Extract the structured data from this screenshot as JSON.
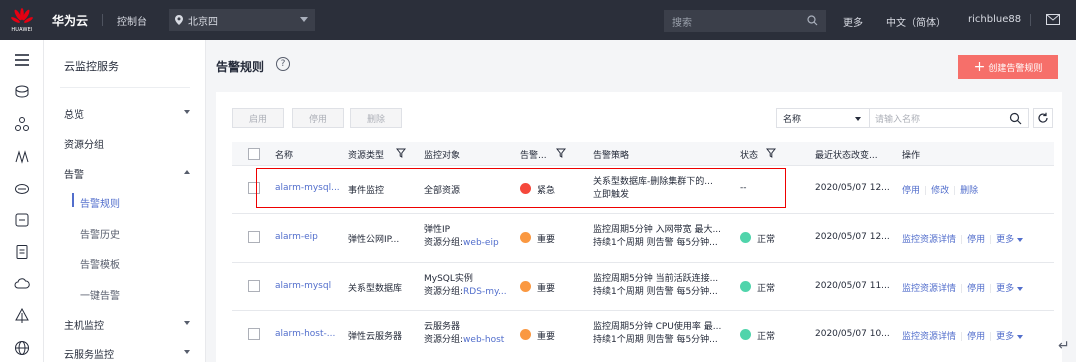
{
  "topbar": {
    "logo_text": "HUAWEI",
    "brand": "华为云",
    "console": "控制台",
    "region": "北京四",
    "search_placeholder": "搜索",
    "more": "更多",
    "language": "中文（简体）",
    "user": "richblue88"
  },
  "sidebar": {
    "title": "云监控服务",
    "items": [
      "总览",
      "资源分组",
      "告警",
      "主机监控",
      "云服务监控"
    ],
    "alarm_sub": [
      "告警规则",
      "告警历史",
      "告警模板",
      "一键告警"
    ]
  },
  "page": {
    "title": "告警规则",
    "create_button": "创建告警规则"
  },
  "toolbar": {
    "enable": "启用",
    "disable": "停用",
    "delete": "删除",
    "filter_field": "名称",
    "filter_placeholder": "请输入名称"
  },
  "table": {
    "headers": [
      "名称",
      "资源类型",
      "监控对象",
      "告警...",
      "告警策略",
      "状态",
      "最近状态改变...",
      "操作"
    ],
    "rows": [
      {
        "name": "alarm-mysql...",
        "resource_type": "事件监控",
        "object_line1": "全部资源",
        "object_line2": "",
        "severity": "紧急",
        "severity_color": "#f5483b",
        "policy_line1": "关系型数据库-删除集群下的...",
        "policy_line2": "立即触发",
        "status": "--",
        "changed": "2020/05/07 12...",
        "ops": [
          "停用",
          "修改",
          "删除"
        ]
      },
      {
        "name": "alarm-eip",
        "resource_type": "弹性公网IP...",
        "object_line1": "弹性IP",
        "object_line2_prefix": "资源分组:",
        "object_line2_link": "web-eip",
        "severity": "重要",
        "severity_color": "#fa9841",
        "policy_line1": "监控周期5分钟 入网带宽 最大...",
        "policy_line2": "持续1个周期 则告警 每5分钟...",
        "status": "正常",
        "changed": "2020/05/07 12...",
        "ops": [
          "监控资源详情",
          "停用",
          "更多"
        ]
      },
      {
        "name": "alarm-mysql",
        "resource_type": "关系型数据库",
        "object_line1": "MySQL实例",
        "object_line2_prefix": "资源分组:",
        "object_line2_link": "RDS-my...",
        "severity": "重要",
        "severity_color": "#fa9841",
        "policy_line1": "监控周期5分钟 当前活跃连接...",
        "policy_line2": "持续1个周期 则告警 每5分钟...",
        "status": "正常",
        "changed": "2020/05/07 11...",
        "ops": [
          "监控资源详情",
          "停用",
          "更多"
        ]
      },
      {
        "name": "alarm-host-...",
        "resource_type": "弹性云服务器",
        "object_line1": "云服务器",
        "object_line2_prefix": "资源分组:",
        "object_line2_link": "web-host",
        "severity": "重要",
        "severity_color": "#fa9841",
        "policy_line1": "监控周期5分钟 CPU使用率 最...",
        "policy_line2": "持续1个周期 则告警 每5分钟...",
        "status": "正常",
        "changed": "2020/05/07 10...",
        "ops": [
          "监控资源详情",
          "停用",
          "更多"
        ]
      }
    ]
  },
  "colors": {
    "accent": "#526ecc",
    "create": "#f66f6a",
    "ok": "#50d4ab",
    "highlight_box": "#ee0000"
  }
}
